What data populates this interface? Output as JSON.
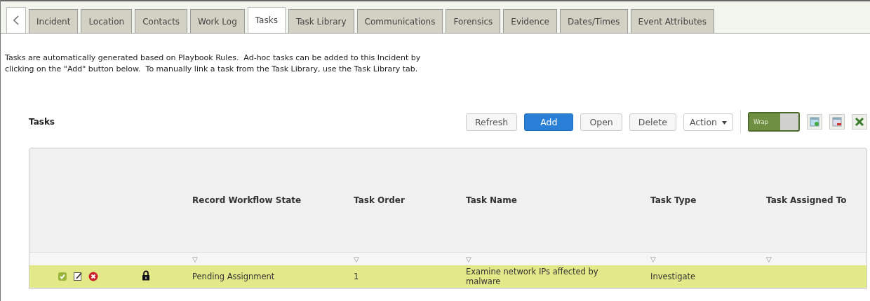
{
  "tabs": [
    {
      "label": "Incident",
      "selected": false
    },
    {
      "label": "Location",
      "selected": false
    },
    {
      "label": "Contacts",
      "selected": false
    },
    {
      "label": "Work Log",
      "selected": false
    },
    {
      "label": "Tasks",
      "selected": true
    },
    {
      "label": "Task Library",
      "selected": false
    },
    {
      "label": "Communications",
      "selected": false
    },
    {
      "label": "Forensics",
      "selected": false
    },
    {
      "label": "Evidence",
      "selected": false
    },
    {
      "label": "Dates/Times",
      "selected": false
    },
    {
      "label": "Event Attributes",
      "selected": false
    }
  ],
  "intro": "Tasks are automatically generated based on Playbook Rules.  Ad-hoc tasks can be added to this Incident by clicking on the \"Add\" button below.  To manually link a task from the Task Library, use the Task Library tab.",
  "section_title": "Tasks",
  "buttons": [
    {
      "label": "Refresh",
      "kind": "plain"
    },
    {
      "label": "Add",
      "kind": "primary"
    },
    {
      "label": "Open",
      "kind": "plain"
    },
    {
      "label": "Delete",
      "kind": "plain"
    }
  ],
  "action_menu": "Action",
  "wrap_toggle": {
    "label": "Wrap",
    "on": true
  },
  "table": {
    "columns": [
      "Record Workflow State",
      "Task Order",
      "Task Name",
      "Task Type",
      "Task Assigned To"
    ],
    "filter_glyph": "▽",
    "rows": [
      {
        "selected": true,
        "locked": true,
        "cells": [
          "Pending Assignment",
          "1",
          "Examine network IPs affected by malware",
          "Investigate",
          ""
        ]
      }
    ]
  }
}
